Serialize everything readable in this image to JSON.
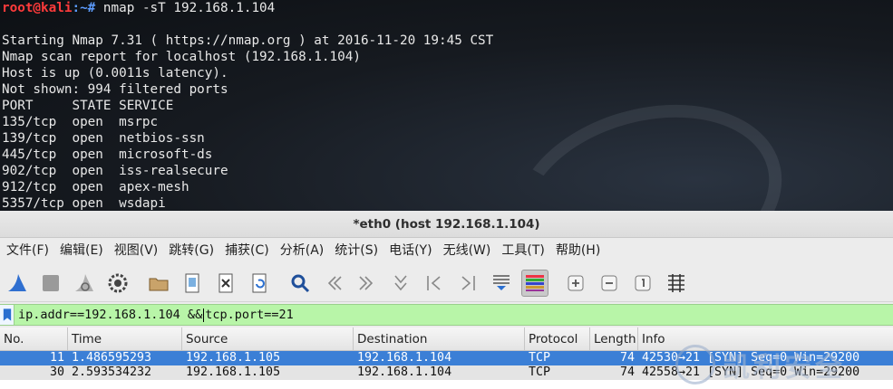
{
  "terminal": {
    "prompt_user": "root@kali",
    "prompt_path": ":~#",
    "command": " nmap -sT 192.168.1.104",
    "output": [
      "",
      "Starting Nmap 7.31 ( https://nmap.org ) at 2016-11-20 19:45 CST",
      "Nmap scan report for localhost (192.168.1.104)",
      "Host is up (0.0011s latency).",
      "Not shown: 994 filtered ports",
      "PORT     STATE SERVICE",
      "135/tcp  open  msrpc",
      "139/tcp  open  netbios-ssn",
      "445/tcp  open  microsoft-ds",
      "902/tcp  open  iss-realsecure",
      "912/tcp  open  apex-mesh",
      "5357/tcp open  wsdapi"
    ]
  },
  "window": {
    "title": "*eth0 (host 192.168.1.104)"
  },
  "menu": [
    "文件(F)",
    "编辑(E)",
    "视图(V)",
    "跳转(G)",
    "捕获(C)",
    "分析(A)",
    "统计(S)",
    "电话(Y)",
    "无线(W)",
    "工具(T)",
    "帮助(H)"
  ],
  "toolbar": {
    "icons": [
      "shark-fin-start-icon",
      "stop-square-icon",
      "restart-fin-icon",
      "capture-options-gear-icon",
      "open-folder-icon",
      "save-file-icon",
      "close-file-icon",
      "reload-file-icon",
      "find-packet-icon",
      "go-back-icon",
      "go-forward-icon",
      "go-to-packet-icon",
      "first-packet-icon",
      "last-packet-icon",
      "autoscroll-icon",
      "colorize-icon",
      "zoom-in-icon",
      "zoom-out-icon",
      "normal-size-icon",
      "resize-columns-icon"
    ],
    "active_icon": "colorize-icon"
  },
  "filter": {
    "before_caret": "ip.addr==192.168.1.104 &&",
    "after_caret": "tcp.port==21"
  },
  "packet_list": {
    "columns": [
      "No.",
      "Time",
      "Source",
      "Destination",
      "Protocol",
      "Length",
      "Info"
    ],
    "rows": [
      {
        "no": "11",
        "time": "1.486595293",
        "source": "192.168.1.105",
        "destination": "192.168.1.104",
        "protocol": "TCP",
        "length": "74",
        "info": "42530→21 [SYN] Seq=0 Win=29200"
      },
      {
        "no": "30",
        "time": "2.593534232",
        "source": "192.168.1.105",
        "destination": "192.168.1.104",
        "protocol": "TCP",
        "length": "74",
        "info": "42558→21 [SYN] Seq=0 Win=29200"
      }
    ],
    "selected_row": 0
  },
  "colors": {
    "filter_bg": "#b8f5a8",
    "selected_row_bg": "#3b7fd6",
    "prompt_user": "#ff3b3b",
    "prompt_path": "#5c9cff"
  },
  "watermark": {
    "text": "凯利安全"
  }
}
